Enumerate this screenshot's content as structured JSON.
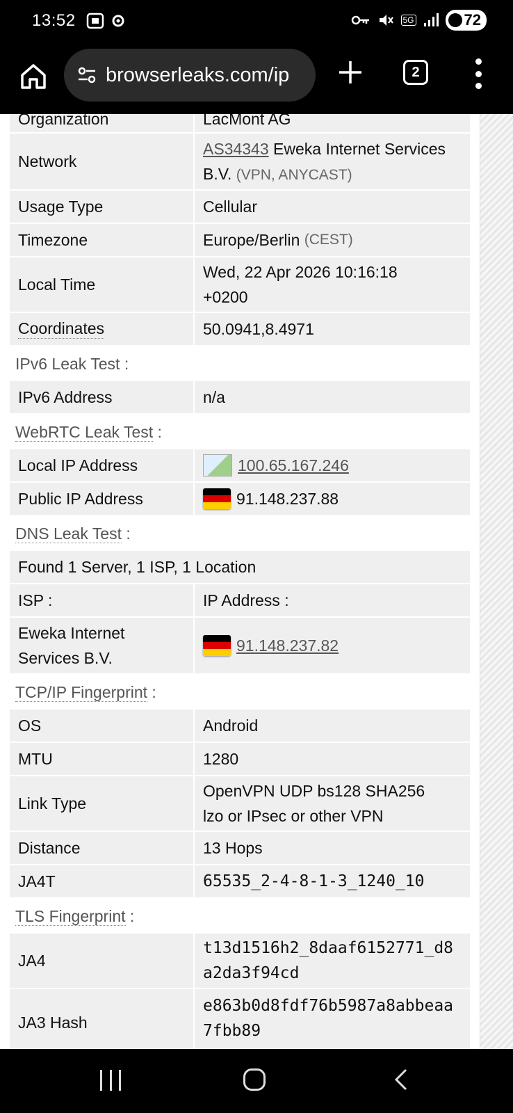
{
  "status_bar": {
    "time": "13:52",
    "battery": "72",
    "network": "5G"
  },
  "browser": {
    "url": "browserleaks.com/ip",
    "tab_count": "2"
  },
  "ip_rows": [
    {
      "key": "Organization",
      "value": "LacMont AG"
    },
    {
      "key": "Network",
      "asn": "AS34343",
      "value": "Eweka Internet Services B.V.",
      "note": "(VPN, ANYCAST)"
    },
    {
      "key": "Usage Type",
      "value": "Cellular"
    },
    {
      "key": "Timezone",
      "value": "Europe/Berlin",
      "note": "(CEST)"
    },
    {
      "key": "Local Time",
      "value": "Wed, 22 Apr 2026 10:16:18 +0200"
    },
    {
      "key": "Coordinates",
      "value": "50.0941,8.4971"
    }
  ],
  "ipv6": {
    "section": "IPv6 Leak Test",
    "key": "IPv6 Address",
    "value": "n/a"
  },
  "webrtc": {
    "section": "WebRTC Leak Test",
    "local_key": "Local IP Address",
    "local_value": "100.65.167.246",
    "public_key": "Public IP Address",
    "public_value": "91.148.237.88"
  },
  "dns": {
    "section": "DNS Leak Test",
    "summary": "Found 1 Server, 1 ISP, 1 Location",
    "isp_header": "ISP :",
    "ip_header": "IP Address :",
    "isp": "Eweka Internet Services B.V.",
    "ip": "91.148.237.82"
  },
  "tcpip": {
    "section": "TCP/IP Fingerprint",
    "rows": [
      {
        "key": "OS",
        "value": "Android"
      },
      {
        "key": "MTU",
        "value": "1280"
      },
      {
        "key": "Link Type",
        "value": "OpenVPN UDP bs128 SHA256 lzo or IPsec or other VPN"
      },
      {
        "key": "Distance",
        "value": "13 Hops"
      },
      {
        "key": "JA4T",
        "value": "65535_2-4-8-1-3_1240_10"
      }
    ]
  },
  "tls": {
    "section": "TLS Fingerprint",
    "ja4_key": "JA4",
    "ja4_value": "t13d1516h2_8daaf6152771_d8a2da3f94cd",
    "ja3_key": "JA3 Hash",
    "ja3_value": "e863b0d8fdf76b5987a8abbeaa7fbb89"
  },
  "colors": {
    "row_bg": "#efefef",
    "section_text": "#555555",
    "toolbar_bg": "#000000",
    "url_pill_bg": "#2b2b2b"
  }
}
